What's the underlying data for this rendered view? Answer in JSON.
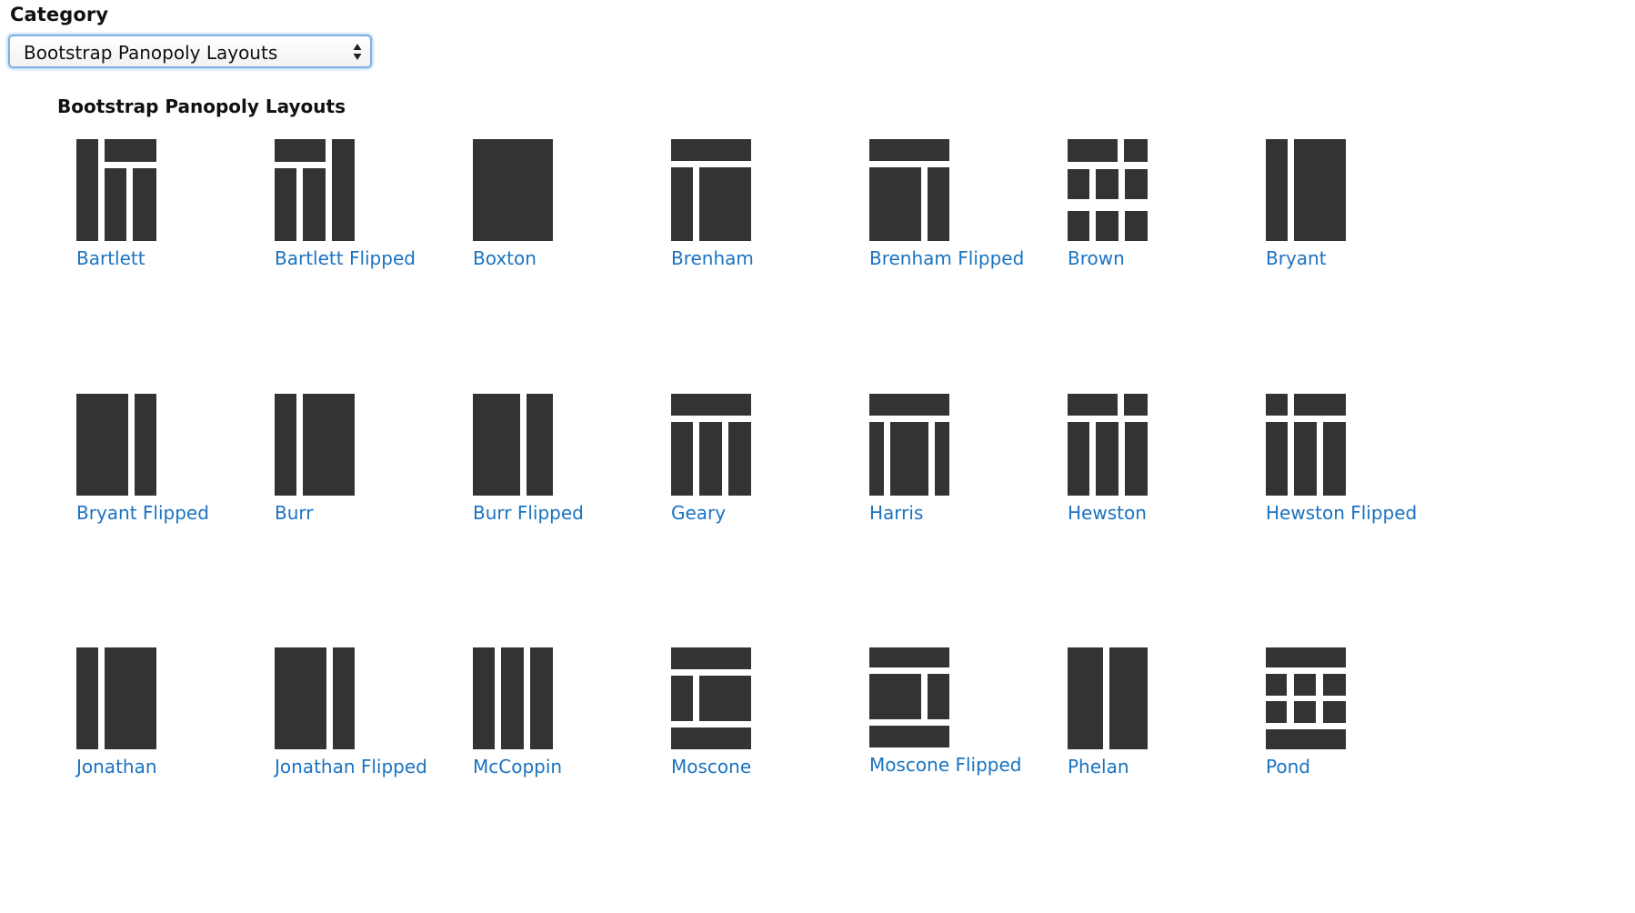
{
  "category": {
    "label": "Category",
    "selected": "Bootstrap Panopoly Layouts"
  },
  "group": {
    "heading": "Bootstrap Panopoly Layouts"
  },
  "layouts": [
    "Bartlett",
    "Bartlett Flipped",
    "Boxton",
    "Brenham",
    "Brenham Flipped",
    "Brown",
    "Bryant",
    "Bryant Flipped",
    "Burr",
    "Burr Flipped",
    "Geary",
    "Harris",
    "Hewston",
    "Hewston Flipped",
    "Jonathan",
    "Jonathan Flipped",
    "McCoppin",
    "Moscone",
    "Moscone Flipped",
    "Phelan",
    "Pond"
  ],
  "colors": {
    "link": "#1a73c1",
    "icon": "#333333",
    "focus": "#7fb0e4"
  }
}
